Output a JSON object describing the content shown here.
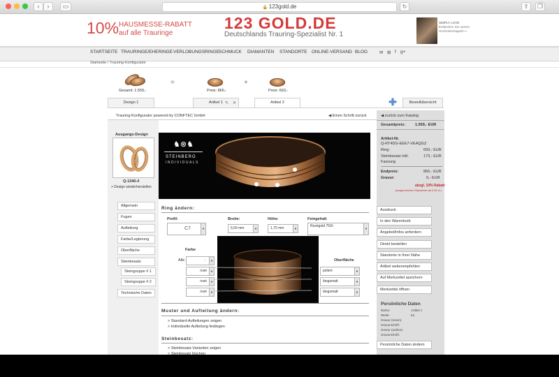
{
  "browser": {
    "url": "123gold.de"
  },
  "header": {
    "promo_pct": "10%",
    "promo_line1": "HAUSMESSE-RABATT",
    "promo_line2": "auf alle Trauringe",
    "logo": "123 GOLD.DE",
    "tagline": "Deutschlands Trauring-Spezialist Nr. 1",
    "ad_line1": "SIMPLY LOVE",
    "ad_line2": "Entdecken Sie unsere",
    "ad_line3": "Hochzeitsmagazin »"
  },
  "nav": {
    "items": [
      "STARTSEITE",
      "TRAURINGE/EHERINGE",
      "VERLOBUNGSRINGE",
      "SCHMUCK",
      "DIAMANTEN",
      "STANDORTE",
      "ONLINE-VERSAND",
      "BLOG"
    ],
    "social": [
      "✉",
      "⊞",
      "f",
      "g+"
    ]
  },
  "breadcrumb": "Startseite  /  Trauring-Konfigurator",
  "summary": {
    "total": "Gesamt: 1.559,-",
    "eq": "=",
    "plus": "+",
    "price1": "Preis: 866,-",
    "price2": "Preis: 693,-"
  },
  "tabs": {
    "design": "Design 1",
    "art1": "Artikel 1",
    "art2": "Artikel 2",
    "best": "Bestellübersicht"
  },
  "config": {
    "title": "Trauring-Konfigurator powered by CONFTEC GmbH",
    "back": "Einen Schritt zurück",
    "ausgang": "Ausgangs-Design",
    "qcode": "Q-1340-4",
    "restore": "> Design wiederherstellen",
    "brand": "STEINBERG",
    "brand_sub": "INDIVIDUALS"
  },
  "leftmenu": [
    "Allgemein",
    "Fugen",
    "Aufteilung",
    "Farbe/Legierung",
    "Oberfläche",
    "Steinbesatz",
    "Steingruppe # 1",
    "Steingruppe # 2",
    "Technische Daten"
  ],
  "ring": {
    "heading": "Ring ändern:",
    "profil_label": "Profil:",
    "profil_value": "C7",
    "breite_label": "Breite:",
    "breite_value": "6,00 mm",
    "hoehe_label": "Höhe:",
    "hoehe_value": "1,70 mm",
    "fein_label": "Feingehalt",
    "fein_value": "Roségold 750/-",
    "farbe_label": "Farbe",
    "ober_label": "Oberfläche",
    "alle": "Alle",
    "alle_sel": "-",
    "colors": [
      "rosé",
      "rosé",
      "rosé"
    ],
    "surfaces": [
      "poliert",
      "längsmatt",
      "längsmatt"
    ]
  },
  "muster": {
    "heading": "Muster und Aufteilung ändern:",
    "link1": "> Standard-Aufteilungen zeigen",
    "link2": "> Individuelle Aufteilung festlegen"
  },
  "stein": {
    "heading": "Steinbesatz:",
    "link1": "> Steinbesatz-Varianten zeigen",
    "link2": "> Steinbesatz löschen"
  },
  "right": {
    "back_catalog": "zurück zum Katalog",
    "gesamt_label": "Gesamtpreis:",
    "gesamt_value": "1.559,- EUR",
    "artnr_label": "Artikel-Nr.",
    "artnr": "Q-RT4DG-EEE7-VEAQGZ",
    "ring_label": "Ring:",
    "ring_value": "693,- EUR",
    "stein_label": "Steinbesatz inkl.",
    "stein_value": "173,- EUR",
    "fassung": "Fassung",
    "end_label": "Endpreis:",
    "end_value": "866,- EUR",
    "grav_label": "Gravur:",
    "grav_value": "0,- EUR",
    "rabatt": "abzgl. 10% Rabatt",
    "rabatt_note": "(ausgenommen Diamanten ab 0,26 ct.)",
    "buttons": [
      "Ausdruck",
      "In den Warenkorb",
      "Angebot/Infos anfordern",
      "Direkt bestellen",
      "Standorte in Ihrer Nähe",
      "Artikel weiterempfehlen",
      "Auf Merkzettel speichern",
      "Merkzettel öffnen"
    ],
    "pd_heading": "Persönliche Daten",
    "pd_name_label": "Name:",
    "pd_name": "Artikel 1",
    "pd_weite_label": "Weite:",
    "pd_weite": "54",
    "pd_g_innen": "Gravur (innen):",
    "pd_schrift1": "Gravurschrift:",
    "pd_g_aussen": "Gravur (außen):",
    "pd_schrift2": "Gravurschrift:",
    "pd_button": "Persönliche Daten ändern"
  }
}
